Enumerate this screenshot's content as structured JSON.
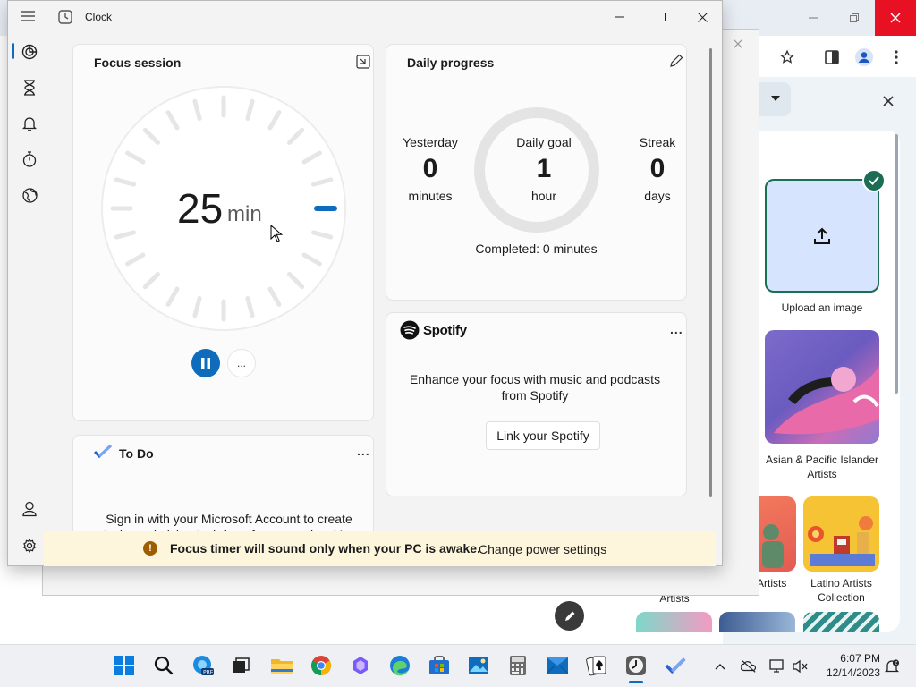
{
  "app": {
    "title": "Clock"
  },
  "focus_session": {
    "title": "Focus session",
    "minutes": "25",
    "unit": "min",
    "more_label": "..."
  },
  "daily_progress": {
    "title": "Daily progress",
    "yesterday": {
      "label": "Yesterday",
      "value": "0",
      "unit": "minutes"
    },
    "goal": {
      "label": "Daily goal",
      "value": "1",
      "unit": "hour"
    },
    "streak": {
      "label": "Streak",
      "value": "0",
      "unit": "days"
    },
    "completed": "Completed: 0 minutes"
  },
  "spotify": {
    "brand": "Spotify",
    "description": "Enhance your focus with music and podcasts from Spotify",
    "link_label": "Link your Spotify",
    "more_label": "..."
  },
  "todo": {
    "title": "To Do",
    "text": "Sign in with your Microsoft Account to create tasks and pick a task for a focus session. You",
    "more_label": "..."
  },
  "notice": {
    "message": "Focus timer will sound only when your PC is awake.",
    "link": "Change power settings"
  },
  "side_panel": {
    "upload_label": "Upload an image",
    "tile_asian": "Asian & Pacific Islander Artists",
    "tile_partial_left": "Artists",
    "tile_partial_mid": "Artists",
    "tile_latino": "Latino Artists Collection"
  },
  "taskbar": {
    "time": "6:07 PM",
    "date": "12/14/2023",
    "icons": [
      "start-icon",
      "search-icon",
      "edge-pre-icon",
      "task-view-icon",
      "file-explorer-icon",
      "chrome-icon",
      "copilot-icon",
      "edge-icon",
      "store-icon",
      "photos-icon",
      "calculator-icon",
      "mail-icon",
      "solitaire-icon",
      "clock-icon",
      "todo-icon"
    ]
  },
  "colors": {
    "accent": "#0f6cbd",
    "notice_bg": "#fdf6dd",
    "close_red": "#e81123"
  }
}
